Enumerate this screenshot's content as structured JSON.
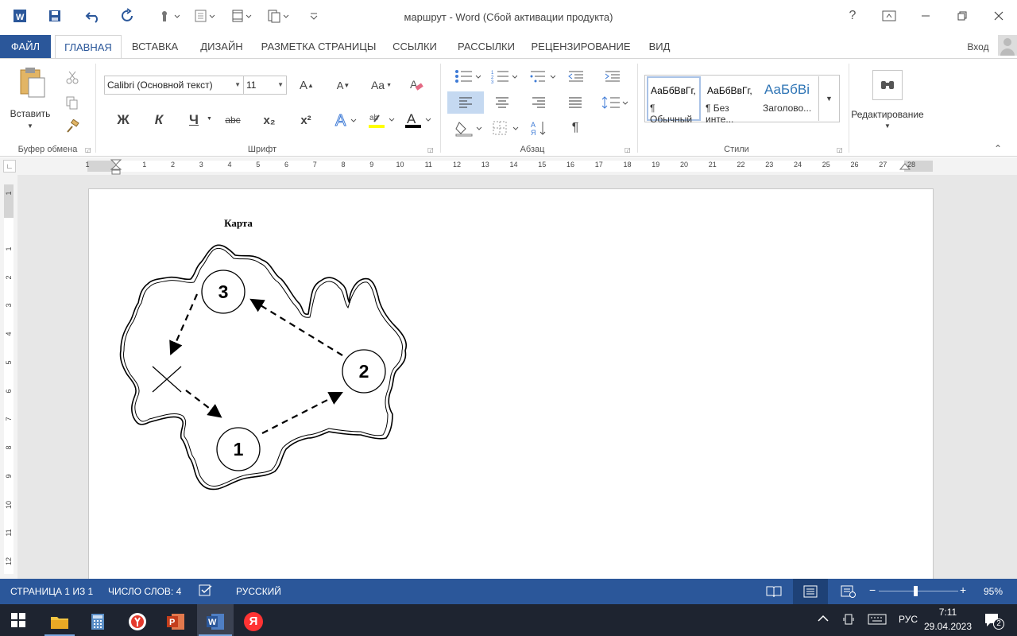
{
  "window": {
    "title": "маршрут - Word (Сбой активации продукта)",
    "help": "?",
    "signin": "Вход"
  },
  "tabs": [
    "ФАЙЛ",
    "ГЛАВНАЯ",
    "ВСТАВКА",
    "ДИЗАЙН",
    "РАЗМЕТКА СТРАНИЦЫ",
    "ССЫЛКИ",
    "РАССЫЛКИ",
    "РЕЦЕНЗИРОВАНИЕ",
    "ВИД"
  ],
  "clipboard": {
    "paste_label": "Вставить",
    "group_label": "Буфер обмена"
  },
  "font": {
    "name": "Calibri (Основной текст)",
    "size": "11",
    "bold": "Ж",
    "italic": "К",
    "underline": "Ч",
    "strike": "abc",
    "sub": "x₂",
    "sup": "x²",
    "grow": "A",
    "shrink": "A",
    "case": "Aa",
    "group_label": "Шрифт"
  },
  "paragraph": {
    "group_label": "Абзац",
    "pilcrow": "¶"
  },
  "styles": {
    "items": [
      {
        "preview": "АаБбВвГг,",
        "name": "¶ Обычный"
      },
      {
        "preview": "АаБбВвГг,",
        "name": "¶ Без инте..."
      },
      {
        "preview": "АаБбВі",
        "name": "Заголово..."
      }
    ],
    "group_label": "Стили"
  },
  "editing": {
    "label": "Редактирование"
  },
  "ruler": {
    "h_ticks": [
      "1",
      "1",
      "2",
      "3",
      "4",
      "5",
      "6",
      "7",
      "8",
      "9",
      "10",
      "11",
      "12",
      "13",
      "14",
      "15",
      "16",
      "17",
      "18",
      "19",
      "20",
      "21",
      "22",
      "23",
      "24",
      "25",
      "26",
      "27",
      "28"
    ],
    "v_ticks": [
      "1",
      "1",
      "2",
      "3",
      "4",
      "5",
      "6",
      "7",
      "8",
      "9",
      "10",
      "11",
      "12"
    ]
  },
  "document": {
    "heading": "Карта",
    "map": {
      "labels": [
        "3",
        "2",
        "1"
      ],
      "route_order": [
        "start",
        "1",
        "2",
        "3",
        "start"
      ]
    }
  },
  "status": {
    "page": "СТРАНИЦА 1 ИЗ 1",
    "words": "ЧИСЛО СЛОВ: 4",
    "language": "РУССКИЙ",
    "zoom": "95%",
    "zoom_minus": "−",
    "zoom_plus": "+",
    "zoom_value": 95
  },
  "taskbar": {
    "lang": "РУС",
    "time": "7:11",
    "date": "29.04.2023",
    "notifications": "2",
    "yandex": "Я"
  },
  "colors": {
    "accent": "#2b579a",
    "taskbar": "#1e2430",
    "highlight": "#ffff00",
    "font_color": "#000000"
  }
}
